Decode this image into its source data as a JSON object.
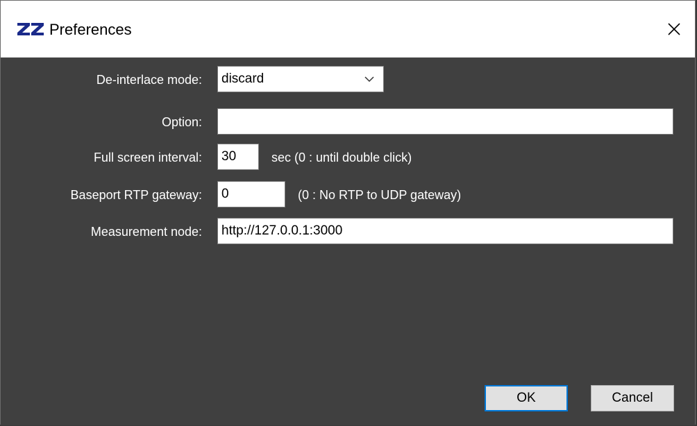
{
  "window": {
    "title": "Preferences",
    "icon": "zz-logo-icon",
    "close_icon": "close-icon"
  },
  "form": {
    "deinterlace": {
      "label": "De-interlace mode:",
      "value": "discard"
    },
    "option": {
      "label": "Option:",
      "value": ""
    },
    "fullscreen": {
      "label": "Full screen interval:",
      "value": "30",
      "hint": "sec (0 : until double click)"
    },
    "baseport": {
      "label": "Baseport RTP gateway:",
      "value": "0",
      "hint": "(0 : No RTP to UDP gateway)"
    },
    "measurement": {
      "label": "Measurement node:",
      "value": "http://127.0.0.1:3000"
    }
  },
  "buttons": {
    "ok": "OK",
    "cancel": "Cancel"
  },
  "colors": {
    "background": "#404040",
    "accent": "#0078d7"
  }
}
